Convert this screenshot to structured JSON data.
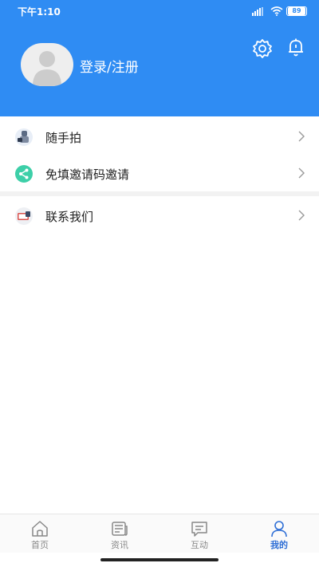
{
  "status_bar": {
    "time": "下午1:10",
    "battery": "89"
  },
  "profile": {
    "login_label": "登录/注册"
  },
  "menu": {
    "items": [
      {
        "label": "随手拍",
        "icon": "camera-person-icon"
      },
      {
        "label": "免填邀请码邀请",
        "icon": "share-icon"
      },
      {
        "label": "联系我们",
        "icon": "contact-icon"
      }
    ]
  },
  "tabbar": {
    "tabs": [
      {
        "label": "首页",
        "icon": "home-icon",
        "active": false
      },
      {
        "label": "资讯",
        "icon": "news-icon",
        "active": false
      },
      {
        "label": "互动",
        "icon": "message-icon",
        "active": false
      },
      {
        "label": "我的",
        "icon": "person-icon",
        "active": true
      }
    ]
  },
  "colors": {
    "brand": "#2f8cf3",
    "active_tab": "#2f6fd6",
    "share_icon": "#3dcfa8"
  }
}
